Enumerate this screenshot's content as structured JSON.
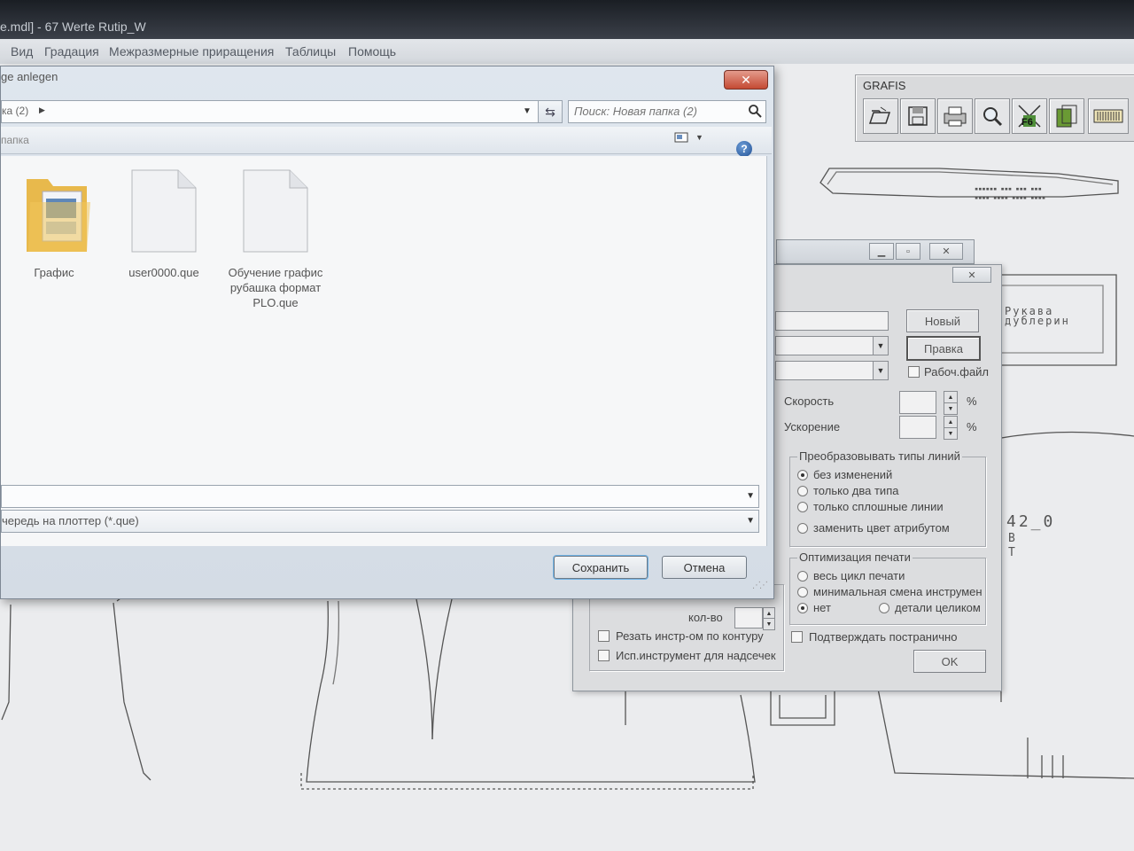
{
  "app": {
    "title": "e.mdl] - 67 Werte Rutip_W",
    "menu": [
      "Вид",
      "Градация",
      "Межразмерные приращения",
      "Таблицы",
      "Помощь"
    ]
  },
  "grafis_toolbar": {
    "title": "GRAFIS",
    "buttons": [
      "open-icon",
      "save-icon",
      "print-icon",
      "zoom-icon",
      "f6-fit-icon",
      "layers-icon",
      "barcode-icon"
    ],
    "f6_label": "F6"
  },
  "drawing_labels": {
    "sleeve": "Рукава",
    "interlining": "дублерин",
    "size_code": "42_0",
    "letter_b": "В",
    "letter_t": "Т"
  },
  "plot_dialog": {
    "new_button": "Новый",
    "edit_button": "Правка",
    "work_file_label": "Рабоч.файл",
    "speed_label": "Скорость",
    "accel_label": "Ускорение",
    "percent": "%",
    "line_types_title": "Преобразовывать типы линий",
    "line_types": [
      {
        "label": "без изменений",
        "selected": true
      },
      {
        "label": "только два типа",
        "selected": false
      },
      {
        "label": "только сплошные линии",
        "selected": false
      },
      {
        "label": "заменить цвет атрибутом",
        "selected": false
      }
    ],
    "optimization_title": "Оптимизация печати",
    "optimization": [
      {
        "label": "весь цикл печати",
        "selected": false
      },
      {
        "label": "минимальная смена инструмента",
        "selected": false
      },
      {
        "label": "нет",
        "selected": true
      }
    ],
    "whole_parts_label": "детали целиком",
    "count_label": "кол-во",
    "cut_contour_label": "Резать инстр-ом по контуру",
    "notch_tool_label": "Исп.инструмент для надсечек",
    "confirm_pages_label": "Подтверждать постранично",
    "ok_button": "OK"
  },
  "save_dialog": {
    "title": "ge anlegen",
    "address": "ка (2)",
    "search_placeholder": "Поиск: Новая папка (2)",
    "folder_label": "папка",
    "files": [
      {
        "name": "Графис",
        "type": "folder"
      },
      {
        "name": "user0000.que",
        "type": "file"
      },
      {
        "name": "Обучение графис рубашка формат PLO.que",
        "type": "file"
      }
    ],
    "filename_value": "",
    "filetype": "чередь на плоттер (*.que)",
    "save_button": "Сохранить",
    "cancel_button": "Отмена"
  }
}
